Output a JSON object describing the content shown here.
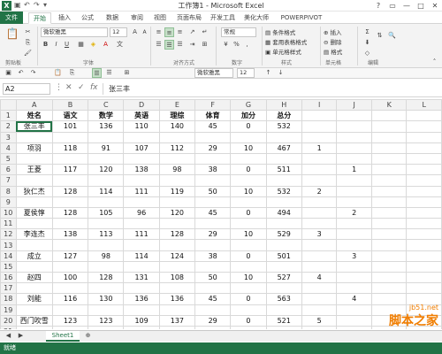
{
  "window": {
    "title": "工作簿1 - Microsoft Excel",
    "controls": [
      "?",
      "▭",
      "—",
      "□",
      "✕"
    ]
  },
  "ribbon": {
    "tabs": [
      "文件",
      "开始",
      "插入",
      "公式",
      "数据",
      "审阅",
      "视图",
      "页面布局",
      "开发工具",
      "美化大师",
      "POWERPIVOT"
    ],
    "font_name": "微软雅黑",
    "font_size": "12",
    "number_format": "常规",
    "groups": [
      "剪贴板",
      "字体",
      "对齐方式",
      "数字",
      "样式",
      "单元格",
      "编辑"
    ],
    "styles": [
      "条件格式",
      "套用表格格式",
      "单元格样式"
    ],
    "cells": [
      "插入",
      "删除",
      "格式"
    ],
    "toolbar2_font": "微软雅黑",
    "toolbar2_size": "12"
  },
  "formula_bar": {
    "name_box": "A2",
    "fx": "fx",
    "value": "张三丰"
  },
  "sheet": {
    "columns": [
      "A",
      "B",
      "C",
      "D",
      "E",
      "F",
      "G",
      "H",
      "I",
      "J",
      "K",
      "L"
    ],
    "rows": [
      [
        "姓名",
        "语文",
        "数学",
        "英语",
        "理综",
        "体育",
        "加分",
        "总分",
        "",
        "",
        "",
        ""
      ],
      [
        "张三丰",
        "101",
        "136",
        "110",
        "140",
        "45",
        "0",
        "532",
        "",
        "",
        "",
        ""
      ],
      [
        "",
        "",
        "",
        "",
        "",
        "",
        "",
        "",
        "",
        "",
        "",
        ""
      ],
      [
        "项羽",
        "118",
        "91",
        "107",
        "112",
        "29",
        "10",
        "467",
        "1",
        "",
        "",
        ""
      ],
      [
        "",
        "",
        "",
        "",
        "",
        "",
        "",
        "",
        "",
        "",
        "",
        ""
      ],
      [
        "王菱",
        "117",
        "120",
        "138",
        "98",
        "38",
        "0",
        "511",
        "",
        "1",
        "",
        ""
      ],
      [
        "",
        "",
        "",
        "",
        "",
        "",
        "",
        "",
        "",
        "",
        "",
        ""
      ],
      [
        "狄仁杰",
        "128",
        "114",
        "111",
        "119",
        "50",
        "10",
        "532",
        "2",
        "",
        "",
        ""
      ],
      [
        "",
        "",
        "",
        "",
        "",
        "",
        "",
        "",
        "",
        "",
        "",
        ""
      ],
      [
        "夏侯惇",
        "128",
        "105",
        "96",
        "120",
        "45",
        "0",
        "494",
        "",
        "2",
        "",
        ""
      ],
      [
        "",
        "",
        "",
        "",
        "",
        "",
        "",
        "",
        "",
        "",
        "",
        ""
      ],
      [
        "李连杰",
        "138",
        "113",
        "111",
        "128",
        "29",
        "10",
        "529",
        "3",
        "",
        "",
        ""
      ],
      [
        "",
        "",
        "",
        "",
        "",
        "",
        "",
        "",
        "",
        "",
        "",
        ""
      ],
      [
        "成立",
        "127",
        "98",
        "114",
        "124",
        "38",
        "0",
        "501",
        "",
        "3",
        "",
        ""
      ],
      [
        "",
        "",
        "",
        "",
        "",
        "",
        "",
        "",
        "",
        "",
        "",
        ""
      ],
      [
        "赵四",
        "100",
        "128",
        "131",
        "108",
        "50",
        "10",
        "527",
        "4",
        "",
        "",
        ""
      ],
      [
        "",
        "",
        "",
        "",
        "",
        "",
        "",
        "",
        "",
        "",
        "",
        ""
      ],
      [
        "刘能",
        "116",
        "130",
        "136",
        "136",
        "45",
        "0",
        "563",
        "",
        "4",
        "",
        ""
      ],
      [
        "",
        "",
        "",
        "",
        "",
        "",
        "",
        "",
        "",
        "",
        "",
        ""
      ],
      [
        "西门吹雪",
        "123",
        "123",
        "109",
        "137",
        "29",
        "0",
        "521",
        "5",
        "",
        "",
        ""
      ],
      [
        "",
        "",
        "",
        "",
        "",
        "",
        "",
        "",
        "",
        "",
        "",
        ""
      ]
    ],
    "tab_name": "Sheet1"
  },
  "status": "就绪",
  "watermark": {
    "site": "jb51.net",
    "label": "脚本之家"
  }
}
